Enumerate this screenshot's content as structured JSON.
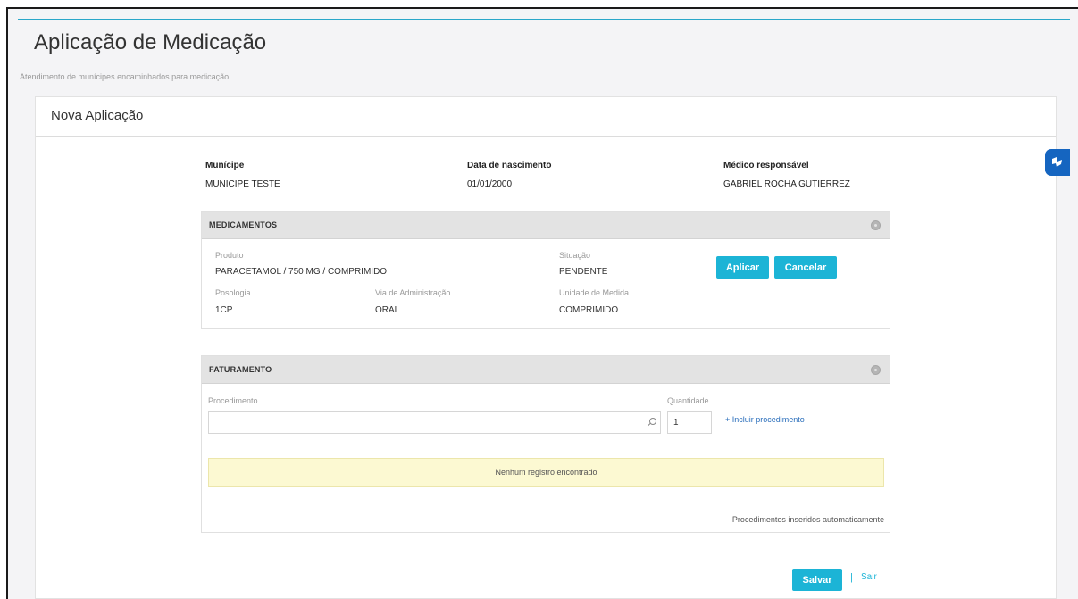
{
  "page": {
    "title": "Aplicação de Medicação",
    "subtitle": "Atendimento de munícipes encaminhados para medicação"
  },
  "card": {
    "title": "Nova Aplicação"
  },
  "patient": {
    "municipe_label": "Munícipe",
    "municipe_value": "MUNICIPE TESTE",
    "birth_label": "Data de nascimento",
    "birth_value": "01/01/2000",
    "doctor_label": "Médico responsável",
    "doctor_value": "GABRIEL ROCHA GUTIERREZ"
  },
  "medicamentos": {
    "header": "MEDICAMENTOS",
    "produto_label": "Produto",
    "produto_value": "PARACETAMOL / 750 MG / COMPRIMIDO",
    "situacao_label": "Situação",
    "situacao_value": "PENDENTE",
    "posologia_label": "Posologia",
    "posologia_value": "1CP",
    "via_label": "Via de Administração",
    "via_value": "ORAL",
    "unidade_label": "Unidade de Medida",
    "unidade_value": "COMPRIMIDO",
    "aplicar_label": "Aplicar",
    "cancelar_label": "Cancelar"
  },
  "faturamento": {
    "header": "FATURAMENTO",
    "procedimento_label": "Procedimento",
    "procedimento_value": "",
    "quantidade_label": "Quantidade",
    "quantidade_value": "1",
    "incluir_link": "+ Incluir procedimento",
    "empty_message": "Nenhum registro encontrado",
    "auto_note": "Procedimentos inseridos automaticamente"
  },
  "footer": {
    "salvar_label": "Salvar",
    "separator": "|",
    "sair_label": "Sair"
  },
  "colors": {
    "accent": "#1cb4d6",
    "link": "#2a6ebb",
    "empty_bg": "#fcf9d2",
    "float_button": "#1565c0"
  },
  "icons": [
    "settings-icon",
    "search-icon",
    "accessibility-icon"
  ]
}
